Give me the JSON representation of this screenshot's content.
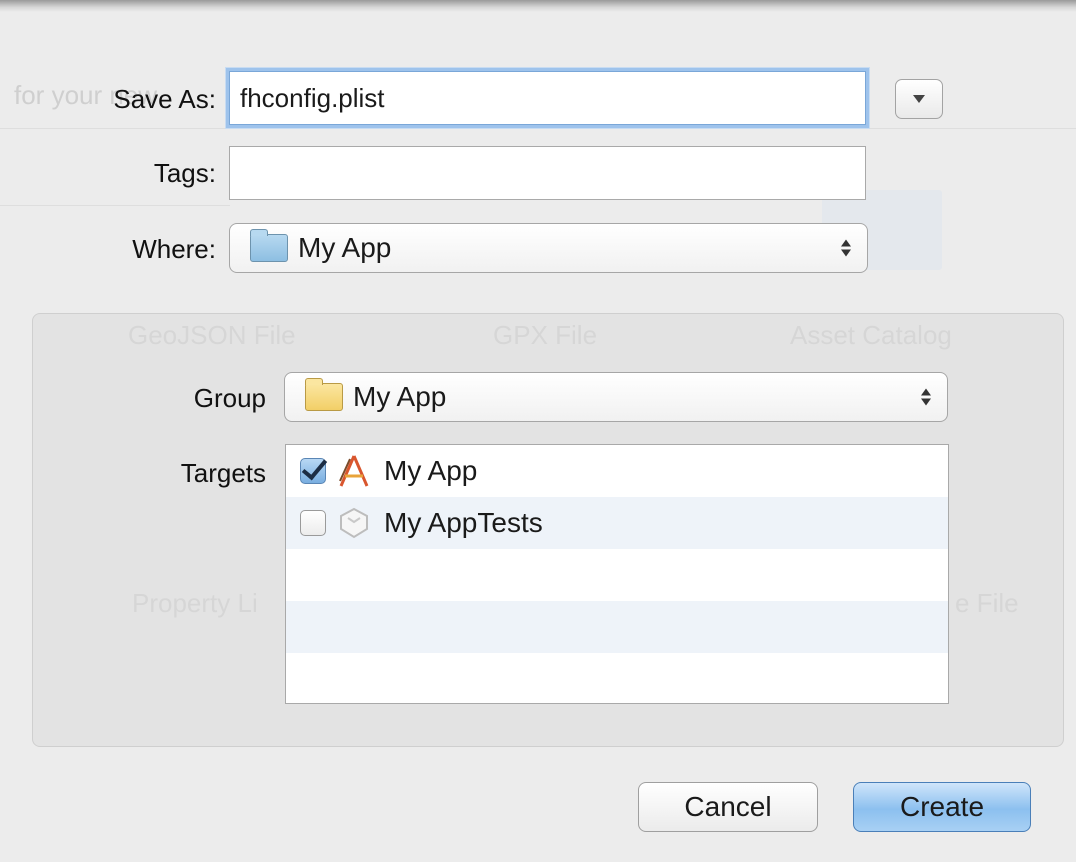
{
  "form": {
    "save_as_label": "Save As:",
    "save_as_value": "fhconfig.plist",
    "tags_label": "Tags:",
    "tags_value": "",
    "where_label": "Where:",
    "where_value": "My App"
  },
  "options": {
    "group_label": "Group",
    "group_value": "My App",
    "targets_label": "Targets",
    "targets": [
      {
        "label": "My App",
        "checked": true,
        "icon": "app-target-icon"
      },
      {
        "label": "My AppTests",
        "checked": false,
        "icon": "test-bundle-icon"
      }
    ]
  },
  "buttons": {
    "cancel": "Cancel",
    "create": "Create"
  },
  "background": {
    "t1": "for your new",
    "t2": "GeoJSON File",
    "t3": "GPX File",
    "t4": "Asset Catalog",
    "t5": "Property Li",
    "t6": "e File"
  },
  "colors": {
    "focus_ring": "#9ec3ec",
    "default_button": "#8cc0ef",
    "alt_row": "#eef3f9"
  }
}
